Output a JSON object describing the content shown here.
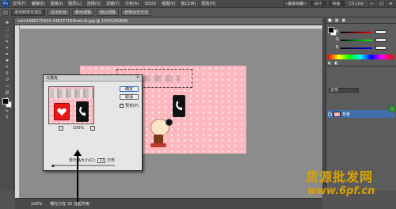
{
  "menubar": {
    "logo": "Ps",
    "items": [
      "文件(F)",
      "编辑(E)",
      "图像(I)",
      "图层(L)",
      "选择(S)",
      "滤镜(T)",
      "分析(A)",
      "3D(D)",
      "视图(V)",
      "窗口(W)",
      "帮助(H)"
    ],
    "mode_buttons": [
      "基本功能",
      "设计",
      "绘画"
    ],
    "cs_live": "CS Live",
    "window_controls": [
      "-",
      "□",
      "×"
    ]
  },
  "options_bar": {
    "style_select": "添加到样本选区",
    "buttons": [
      "写出形状",
      "移出调整",
      "侧边调整",
      "样例对齐方式"
    ]
  },
  "document": {
    "tab_title": "mm1480175414 248157158mm.fs.jpg @ 100%(RGB/8)"
  },
  "status_bar": {
    "zoom": "100%",
    "info": "曝光只在 32 位起作用"
  },
  "layers": {
    "blend_mode": "正常",
    "layer_name": "背景"
  },
  "dialog": {
    "title": "马赛克",
    "close": "×",
    "zoom_minus": "-",
    "zoom_plus": "+",
    "zoom_level": "100%",
    "ok": "确定",
    "cancel": "取消",
    "preview_label": "预览(P)",
    "cell_size_label": "单元格大小(C):",
    "cell_size_value": "10",
    "cell_size_unit": "方形"
  },
  "watermark": {
    "title": "货源批发网",
    "url": "www.6pf.cn"
  }
}
